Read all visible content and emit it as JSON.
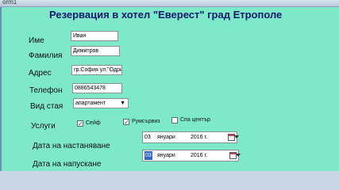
{
  "window": {
    "title": "orm1"
  },
  "form": {
    "title": "Резервация в хотел \"Еверест\" град Етрополе",
    "fields": {
      "name": {
        "label": "Име",
        "value": "Иван"
      },
      "surname": {
        "label": "Фамилия",
        "value": "Димитров"
      },
      "address": {
        "label": "Адрес",
        "value": "гр.София ул.\"Одри"
      },
      "phone": {
        "label": "Телефон",
        "value": "0886543478"
      },
      "room_type": {
        "label": "Вид стая",
        "value": "апартамент"
      }
    },
    "services": {
      "label": "Услуги",
      "items": [
        {
          "label": "Сейф",
          "checked": true
        },
        {
          "label": "Румсървиз",
          "checked": true
        },
        {
          "label": "Спа център",
          "checked": false
        }
      ]
    },
    "checkin": {
      "label": "Дата на настаняване",
      "day": "03",
      "month": "януари",
      "year": "2016 г."
    },
    "checkout": {
      "label": "Дата на напускане",
      "day": "03",
      "month": "януари",
      "year": "2016 г."
    }
  },
  "icons": {
    "dropdown": "chevron-down-icon",
    "calendar": "calendar-icon",
    "check": "checkmark-icon"
  }
}
